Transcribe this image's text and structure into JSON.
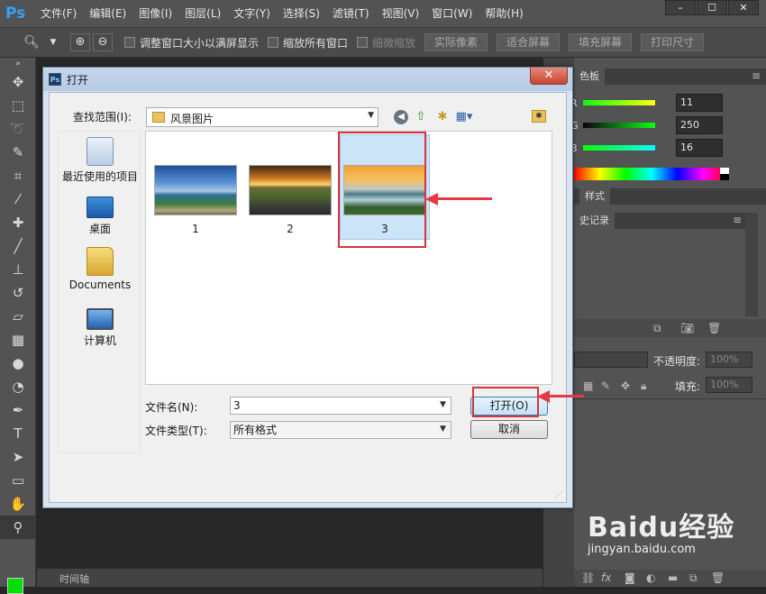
{
  "app": {
    "logo": "Ps",
    "menu": [
      "文件(F)",
      "编辑(E)",
      "图像(I)",
      "图层(L)",
      "文字(Y)",
      "选择(S)",
      "滤镜(T)",
      "视图(V)",
      "窗口(W)",
      "帮助(H)"
    ],
    "window_buttons": [
      "–",
      "☐",
      "✕"
    ]
  },
  "options_bar": {
    "checkbox1": "调整窗口大小以满屏显示",
    "checkbox2": "缩放所有窗口",
    "checkbox3": "细微缩放",
    "btn_actual": "实际像素",
    "btn_fit": "适合屏幕",
    "btn_fill": "填充屏幕",
    "btn_print": "打印尺寸"
  },
  "right_panel": {
    "tab_color": "色板",
    "r_label": "R",
    "r_value": "11",
    "g_label": "G",
    "g_value": "250",
    "b_label": "B",
    "b_value": "16",
    "tab_styles": "样式",
    "tab_history": "史记录",
    "opacity_label": "不透明度:",
    "opacity_value": "100%",
    "fill_label": "填充:",
    "fill_value": "100%"
  },
  "timeline": {
    "label": "时间轴"
  },
  "watermark": {
    "brand": "Baidu经验",
    "url": "jingyan.baidu.com"
  },
  "dialog": {
    "title": "打开",
    "close": "✕",
    "look_in_label": "查找范围(I):",
    "look_in_value": "风景图片",
    "places": [
      "最近使用的项目",
      "桌面",
      "Documents",
      "计算机"
    ],
    "files": [
      {
        "name": "1"
      },
      {
        "name": "2"
      },
      {
        "name": "3"
      }
    ],
    "filename_label": "文件名(N):",
    "filename_value": "3",
    "filetype_label": "文件类型(T):",
    "filetype_value": "所有格式",
    "open_button": "打开(O)",
    "cancel_button": "取消"
  },
  "colors": {
    "annotation_red": "#e53946",
    "foreground_swatch": "#00e000"
  }
}
